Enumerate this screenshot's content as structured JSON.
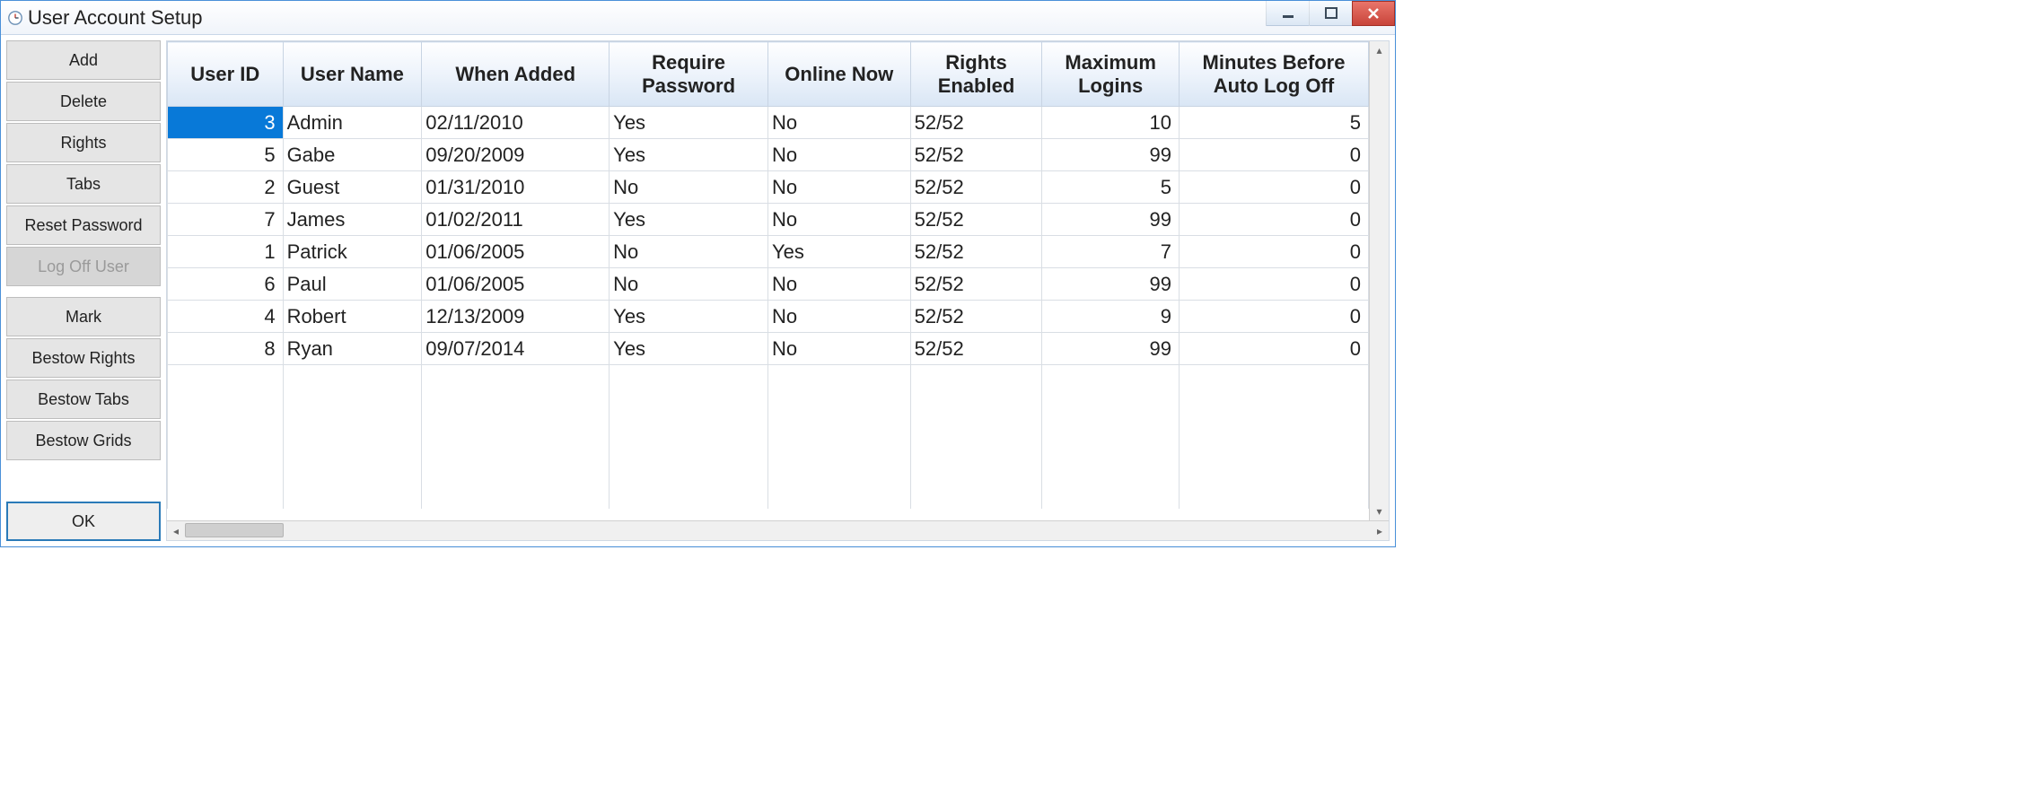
{
  "window": {
    "title": "User Account Setup"
  },
  "sidebar": {
    "add": "Add",
    "delete": "Delete",
    "rights": "Rights",
    "tabs": "Tabs",
    "reset_password": "Reset Password",
    "log_off_user": "Log Off User",
    "mark": "Mark",
    "bestow_rights": "Bestow Rights",
    "bestow_tabs": "Bestow Tabs",
    "bestow_grids": "Bestow Grids",
    "ok": "OK"
  },
  "grid": {
    "headers": {
      "user_id": "User ID",
      "user_name": "User Name",
      "when_added": "When Added",
      "require_password": "Require Password",
      "online_now": "Online Now",
      "rights_enabled": "Rights Enabled",
      "maximum_logins": "Maximum Logins",
      "minutes_before_auto_log_off": "Minutes Before Auto Log Off"
    },
    "rows": [
      {
        "user_id": "3",
        "user_name": "Admin",
        "when_added": "02/11/2010",
        "require_password": "Yes",
        "online_now": "No",
        "rights_enabled": "52/52",
        "maximum_logins": "10",
        "auto_log_off": "5"
      },
      {
        "user_id": "5",
        "user_name": "Gabe",
        "when_added": "09/20/2009",
        "require_password": "Yes",
        "online_now": "No",
        "rights_enabled": "52/52",
        "maximum_logins": "99",
        "auto_log_off": "0"
      },
      {
        "user_id": "2",
        "user_name": "Guest",
        "when_added": "01/31/2010",
        "require_password": "No",
        "online_now": "No",
        "rights_enabled": "52/52",
        "maximum_logins": "5",
        "auto_log_off": "0"
      },
      {
        "user_id": "7",
        "user_name": "James",
        "when_added": "01/02/2011",
        "require_password": "Yes",
        "online_now": "No",
        "rights_enabled": "52/52",
        "maximum_logins": "99",
        "auto_log_off": "0"
      },
      {
        "user_id": "1",
        "user_name": "Patrick",
        "when_added": "01/06/2005",
        "require_password": "No",
        "online_now": "Yes",
        "rights_enabled": "52/52",
        "maximum_logins": "7",
        "auto_log_off": "0"
      },
      {
        "user_id": "6",
        "user_name": "Paul",
        "when_added": "01/06/2005",
        "require_password": "No",
        "online_now": "No",
        "rights_enabled": "52/52",
        "maximum_logins": "99",
        "auto_log_off": "0"
      },
      {
        "user_id": "4",
        "user_name": "Robert",
        "when_added": "12/13/2009",
        "require_password": "Yes",
        "online_now": "No",
        "rights_enabled": "52/52",
        "maximum_logins": "9",
        "auto_log_off": "0"
      },
      {
        "user_id": "8",
        "user_name": "Ryan",
        "when_added": "09/07/2014",
        "require_password": "Yes",
        "online_now": "No",
        "rights_enabled": "52/52",
        "maximum_logins": "99",
        "auto_log_off": "0"
      }
    ],
    "selected_row_index": 0,
    "selected_col": "user_id"
  }
}
